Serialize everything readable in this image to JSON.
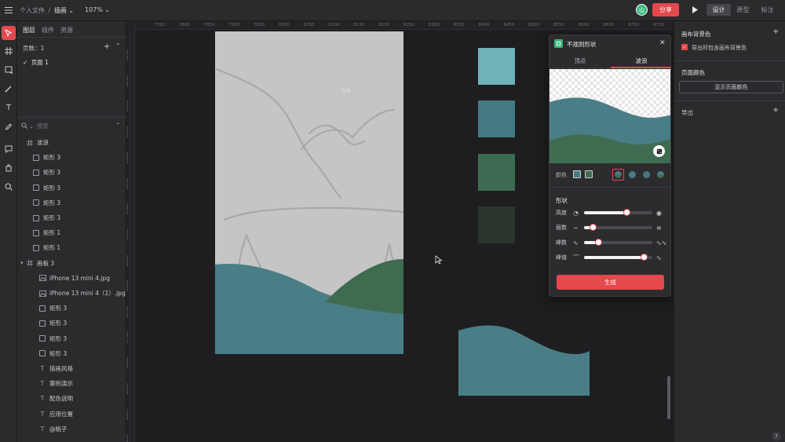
{
  "topbar": {
    "breadcrumb_root": "个人文件",
    "breadcrumb_sep": "/",
    "file_name": "插画",
    "zoom": "107%",
    "avatar_initial": "山",
    "share_label": "分享",
    "mode_tabs": [
      "设计",
      "原型",
      "标注"
    ]
  },
  "leftpanel": {
    "tabs": [
      "图层",
      "组件",
      "资源"
    ],
    "pages_label": "页数：1",
    "page_item": "页面 1",
    "search_placeholder": "搜索",
    "layers": [
      {
        "name": "波浪",
        "icon": "frame"
      },
      {
        "name": "矩形 3",
        "icon": "rect"
      },
      {
        "name": "矩形 3",
        "icon": "rect"
      },
      {
        "name": "矩形 3",
        "icon": "rect"
      },
      {
        "name": "矩形 3",
        "icon": "rect"
      },
      {
        "name": "矩形 3",
        "icon": "rect"
      },
      {
        "name": "矩形 1",
        "icon": "rect"
      },
      {
        "name": "矩形 1",
        "icon": "rect"
      },
      {
        "name": "画板 3",
        "icon": "frame"
      },
      {
        "name": "iPhone 13 mini 4.jpg",
        "icon": "image"
      },
      {
        "name": "iPhone 13 mini 4（1）.jpg",
        "icon": "image"
      },
      {
        "name": "矩形 3",
        "icon": "rect"
      },
      {
        "name": "矩形 3",
        "icon": "rect"
      },
      {
        "name": "矩形 3",
        "icon": "rect"
      },
      {
        "name": "矩形 3",
        "icon": "rect"
      },
      {
        "name": "插画风格",
        "icon": "text"
      },
      {
        "name": "案例演示",
        "icon": "text"
      },
      {
        "name": "配色说明",
        "icon": "text"
      },
      {
        "name": "应用位置",
        "icon": "text"
      },
      {
        "name": "@桃子",
        "icon": "text"
      }
    ]
  },
  "canvas": {
    "ruler_x": [
      "7750",
      "7800",
      "7850",
      "7900",
      "7950",
      "8000",
      "8050",
      "8100",
      "8150",
      "8200",
      "8250",
      "8300",
      "8350",
      "8400",
      "8450",
      "8500",
      "8550",
      "8600",
      "8650",
      "8700",
      "8750"
    ],
    "ruler_y": [
      "8200",
      "8250",
      "8300",
      "8350",
      "8400",
      "8450",
      "8500",
      "8550",
      "8600",
      "8650",
      "8700",
      "8750",
      "8800",
      "8850",
      "8900",
      "8950"
    ],
    "artboard_text": "背景",
    "swatch_colors": [
      "#6fb3b8",
      "#457a85",
      "#3d6b51",
      "#2b362f"
    ],
    "wave_colors": {
      "teal": "#4a7e86",
      "green": "#3f6b51",
      "artboard": "#c5c5c5"
    }
  },
  "popup": {
    "title": "不规则形状",
    "tabs": [
      "顶点",
      "波浪"
    ],
    "color_label": "颜色",
    "shape_label": "形状",
    "sliders": [
      {
        "label": "高度",
        "value": 0.62
      },
      {
        "label": "层数",
        "value": 0.13
      },
      {
        "label": "峰数",
        "value": 0.21
      },
      {
        "label": "峰值",
        "value": 0.87
      }
    ],
    "generate_label": "生成"
  },
  "rightpanel": {
    "canvas_bg_title": "画布背景色",
    "export_include_bg": "导出时包含画布背景色",
    "page_color_title": "页面颜色",
    "show_page_color": "显示页面颜色",
    "export_title": "导出"
  },
  "icons": [
    "menu-icon",
    "chevron-down-icon",
    "play-icon",
    "move-icon",
    "frame-icon",
    "rect-icon",
    "pen-icon",
    "text-icon",
    "pencil-icon",
    "comment-icon",
    "plugin-icon",
    "search-icon",
    "plus-icon",
    "close-icon",
    "dice-icon",
    "help-icon"
  ],
  "accent": "#e5484d"
}
